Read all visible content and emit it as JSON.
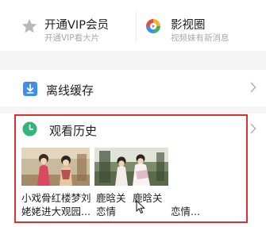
{
  "vip": {
    "title": "开通VIP会员",
    "subtitle": "开通VIP看大片",
    "icon": "star-icon"
  },
  "video_circle": {
    "title": "影视圈",
    "subtitle": "视频妹有新消息",
    "icon": "video-circle-icon"
  },
  "offline": {
    "title": "离线缓存",
    "icon": "download-icon"
  },
  "history": {
    "title": "观看历史",
    "icon": "clock-icon",
    "items": [
      {
        "line1": "小戏骨红楼梦刘",
        "line2": "姥姥进大观园..."
      },
      {
        "line1": "鹿晗关",
        "line2": "恋情"
      },
      {
        "line1": "鹿晗关",
        "line2": "恋情..."
      }
    ]
  },
  "colors": {
    "highlight_border": "#d7332f",
    "download_blue": "#3d8fea",
    "clock_green": "#34b37a"
  }
}
